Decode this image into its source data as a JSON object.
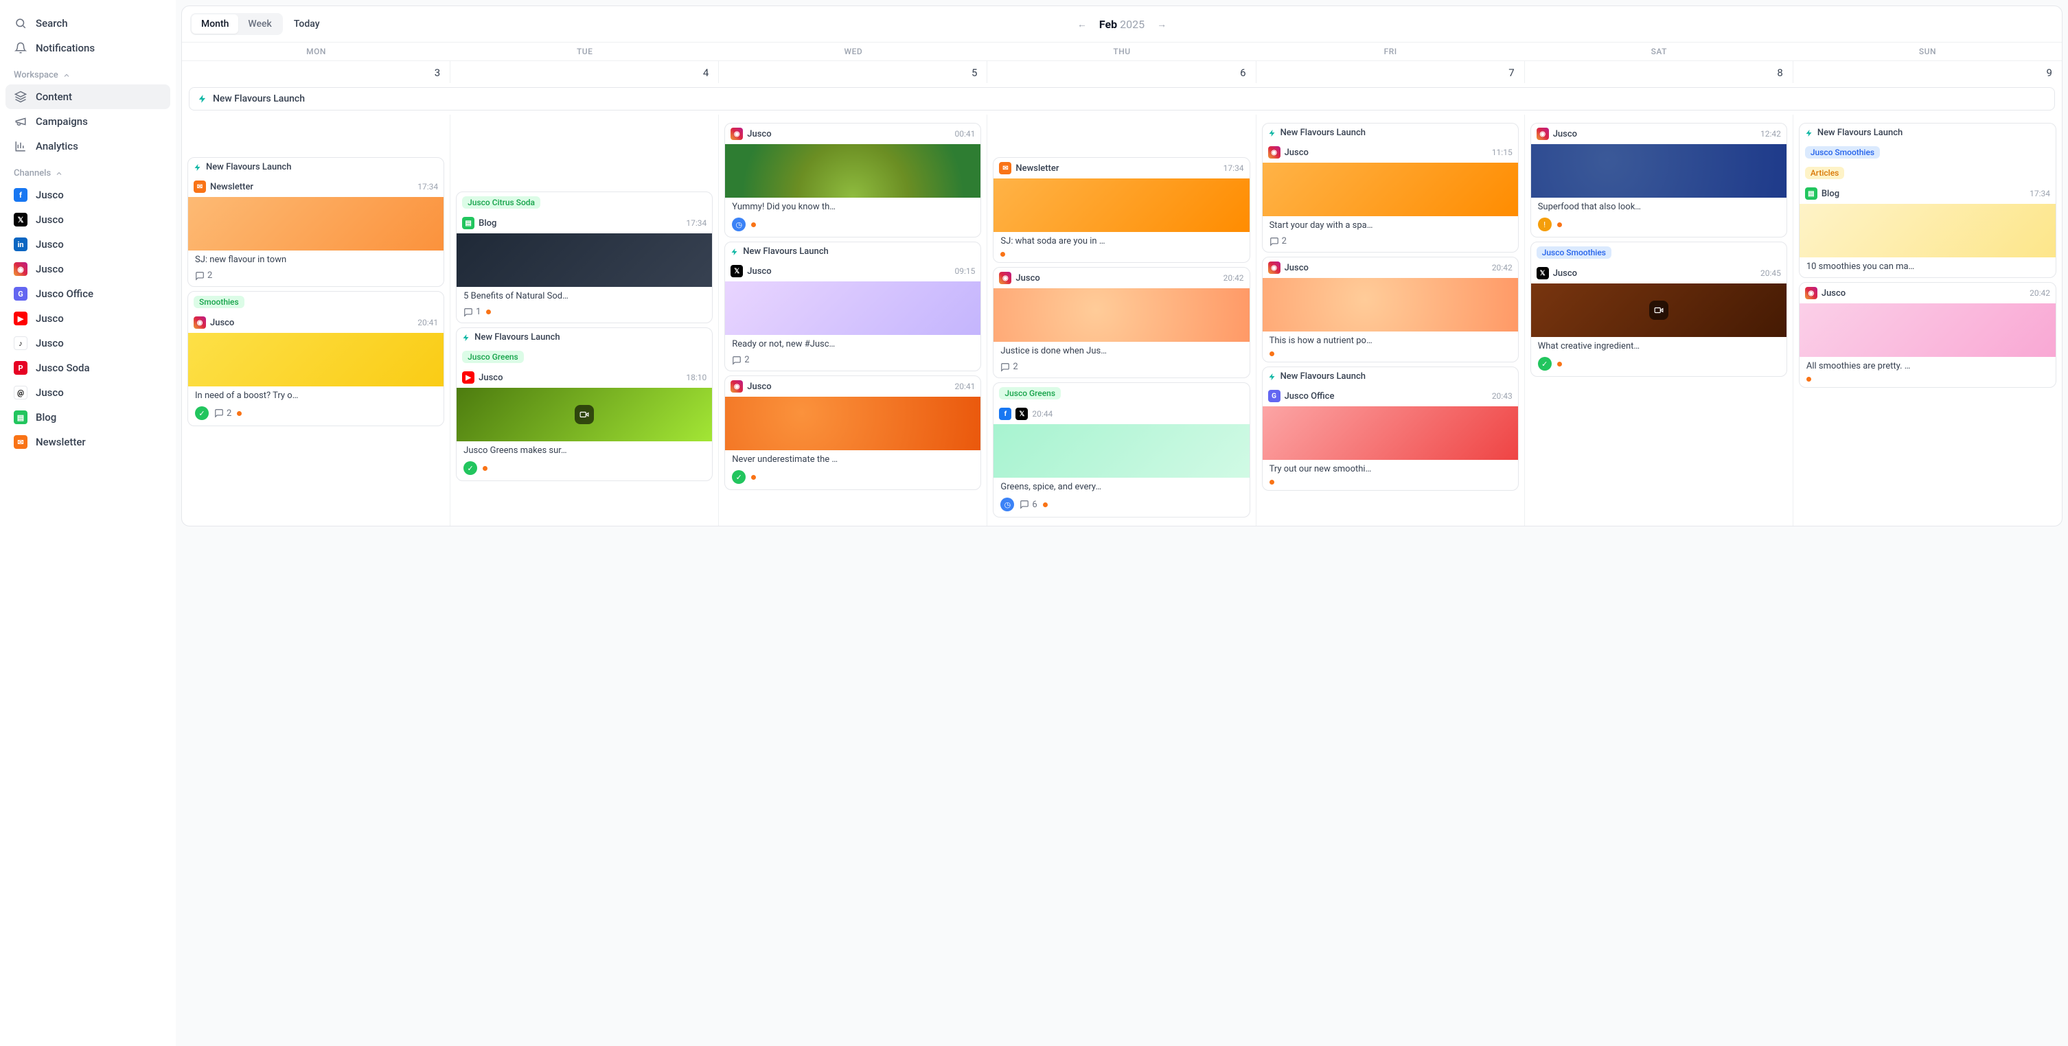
{
  "sidebar": {
    "search": "Search",
    "notifications": "Notifications",
    "workspace_label": "Workspace",
    "nav": [
      {
        "id": "content",
        "label": "Content",
        "active": true
      },
      {
        "id": "campaigns",
        "label": "Campaigns"
      },
      {
        "id": "analytics",
        "label": "Analytics"
      }
    ],
    "channels_label": "Channels",
    "channels": [
      {
        "icon": "fb",
        "label": "Jusco"
      },
      {
        "icon": "x",
        "label": "Jusco"
      },
      {
        "icon": "li",
        "label": "Jusco"
      },
      {
        "icon": "ig",
        "label": "Jusco"
      },
      {
        "icon": "g",
        "label": "Jusco Office"
      },
      {
        "icon": "yt",
        "label": "Jusco"
      },
      {
        "icon": "tk",
        "label": "Jusco"
      },
      {
        "icon": "pin",
        "label": "Jusco Soda"
      },
      {
        "icon": "th",
        "label": "Jusco"
      },
      {
        "icon": "doc",
        "label": "Blog"
      },
      {
        "icon": "nl",
        "label": "Newsletter"
      }
    ]
  },
  "calendar": {
    "views": {
      "month": "Month",
      "week": "Week",
      "today": "Today"
    },
    "month": "Feb",
    "year": "2025",
    "dow": [
      "MON",
      "TUE",
      "WED",
      "THU",
      "FRI",
      "SAT",
      "SUN"
    ],
    "dates": [
      "3",
      "4",
      "5",
      "6",
      "7",
      "8",
      "9"
    ],
    "banner": "New Flavours Launch"
  },
  "posts": {
    "mon": [
      {
        "type": "camp",
        "camp": "New Flavours Launch",
        "sub_icon": "nl",
        "sub": "Newsletter",
        "time": "17:34",
        "thumb": "smoothie",
        "cap": "SJ: new flavour in town",
        "comments": "2"
      },
      {
        "type": "pill",
        "pill": "Smoothies",
        "pill_cls": "green",
        "sub_icon": "ig",
        "sub": "Jusco",
        "time": "20:41",
        "thumb": "yellow",
        "cap": "In need of a boost? Try o…",
        "badge": "ok",
        "comments": "2",
        "dot": true
      }
    ],
    "tue": [
      {
        "type": "pill",
        "pill": "Jusco Citrus Soda",
        "pill_cls": "green",
        "sub_icon": "doc",
        "sub": "Blog",
        "time": "17:34",
        "thumb": "dark",
        "cap": "5 Benefits of Natural Sod…",
        "comments": "1",
        "dot": true
      },
      {
        "type": "camp",
        "camp": "New Flavours Launch",
        "pill": "Jusco Greens",
        "pill_cls": "green",
        "sub_icon": "yt",
        "sub": "Jusco",
        "time": "18:10",
        "thumb": "avo",
        "video": true,
        "cap": "Jusco Greens makes sur…",
        "badge": "ok",
        "dot": true
      }
    ],
    "wed": [
      {
        "type": "plain",
        "sub_icon": "ig",
        "sub": "Jusco",
        "time": "00:41",
        "thumb": "kiwi",
        "cap": "Yummy! Did you know th…",
        "badge": "clock",
        "dot": true
      },
      {
        "type": "camp",
        "camp": "New Flavours Launch",
        "sub_icon": "x",
        "sub": "Jusco",
        "time": "09:15",
        "thumb": "bottle",
        "cap": "Ready or not, new #Jusc…",
        "comments": "2"
      },
      {
        "type": "plain",
        "sub_icon": "ig",
        "sub": "Jusco",
        "time": "20:41",
        "thumb": "citrus",
        "cap": "Never underestimate the …",
        "badge": "ok",
        "dot": true
      }
    ],
    "thu": [
      {
        "type": "plain",
        "sub_icon": "nl",
        "sub": "Newsletter",
        "time": "17:34",
        "thumb": "orange",
        "cap": "SJ: what soda are you in …",
        "dot": true
      },
      {
        "type": "plain",
        "sub_icon": "ig",
        "sub": "Jusco",
        "time": "20:42",
        "thumb": "peach",
        "cap": "Justice is done when Jus…",
        "comments": "2"
      },
      {
        "type": "pill",
        "pill": "Jusco Greens",
        "pill_cls": "green",
        "sub_icon2": [
          "fb",
          "x"
        ],
        "time": "20:44",
        "thumb": "mint",
        "cap": "Greens, spice, and every…",
        "badge": "clock",
        "comments": "6",
        "dot": true
      }
    ],
    "fri": [
      {
        "type": "camp",
        "camp": "New Flavours Launch",
        "sub_icon": "ig",
        "sub": "Jusco",
        "time": "11:15",
        "thumb": "orange",
        "cap": "Start your day with a spa…",
        "comments": "2"
      },
      {
        "type": "plain",
        "sub_icon": "ig",
        "sub": "Jusco",
        "time": "20:42",
        "thumb": "peach",
        "cap": "This is how a nutrient po…",
        "dot": true
      },
      {
        "type": "camp",
        "camp": "New Flavours Launch",
        "sub_icon": "g",
        "sub": "Jusco Office",
        "time": "20:43",
        "thumb": "red",
        "cap": "Try out our new smoothi…",
        "dot": true
      }
    ],
    "sat": [
      {
        "type": "plain",
        "sub_icon": "ig",
        "sub": "Jusco",
        "time": "12:42",
        "thumb": "blue",
        "cap": "Superfood that also look…",
        "badge": "warn",
        "dot": true
      },
      {
        "type": "pill",
        "pill": "Jusco Smoothies",
        "pill_cls": "blue",
        "sub_icon": "x",
        "sub": "Jusco",
        "time": "20:45",
        "thumb": "brown",
        "video": true,
        "cap": "What creative ingredient…",
        "badge": "ok",
        "dot": true
      }
    ],
    "sun": [
      {
        "type": "camp",
        "camp": "New Flavours Launch",
        "pill": "Jusco Smoothies",
        "pill_cls": "blue",
        "pill2": "Articles",
        "pill2_cls": "amber",
        "sub_icon": "doc",
        "sub": "Blog",
        "time": "17:34",
        "thumb": "cream",
        "cap": "10 smoothies you can ma…"
      },
      {
        "type": "plain",
        "sub_icon": "ig",
        "sub": "Jusco",
        "time": "20:42",
        "thumb": "pink",
        "cap": "All smoothies are pretty. …",
        "dot": true
      }
    ]
  }
}
